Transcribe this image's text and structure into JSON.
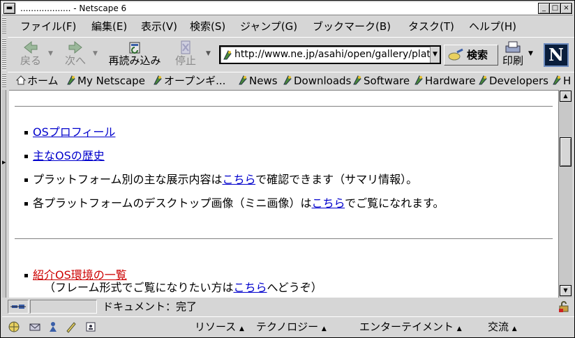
{
  "window": {
    "title": "................... - Netscape 6",
    "buttons": [
      "_",
      "□",
      "×"
    ]
  },
  "menubar": {
    "items": [
      "ファイル(F)",
      "編集(E)",
      "表示(V)",
      "検索(S)",
      "ジャンプ(G)",
      "ブックマーク(B)",
      "タスク(T)",
      "ヘルプ(H)"
    ]
  },
  "toolbar": {
    "back": "戻る",
    "forward": "次へ",
    "reload": "再読み込み",
    "stop": "停止",
    "url": "http://www.ne.jp/asahi/open/gallery/plat",
    "search": "検索",
    "print": "印刷",
    "logo": "N"
  },
  "personal_toolbar": {
    "home": "ホーム",
    "items": [
      "My Netscape",
      "オープンギ...",
      "News",
      "Downloads",
      "Software",
      "Hardware",
      "Developers",
      "H"
    ]
  },
  "content": {
    "item1": "OSプロフィール",
    "item2": "主なOSの歴史",
    "item3_pre": "プラットフォーム別の主な展示内容は",
    "item3_link": "こちら",
    "item3_post": "で確認できます（サマリ情報）。",
    "item4_pre": "各プラットフォームのデスクトップ画像（ミニ画像）は",
    "item4_link": "こちら",
    "item4_post": "でご覧になれます。",
    "item5": "紹介OS環境の一覧",
    "item5_sub_pre": "（フレーム形式でご覧になりたい方は",
    "item5_sub_link": "こちら",
    "item5_sub_post": "へどうぞ）"
  },
  "status": {
    "text": "ドキュメント：完了"
  },
  "taskbar": {
    "menus": [
      "リソース",
      "テクノロジー",
      "エンターテイメント",
      "交流"
    ]
  },
  "colors": {
    "link": "#0000cc",
    "red_link": "#cc0000",
    "chrome": "#d6d6d6"
  }
}
